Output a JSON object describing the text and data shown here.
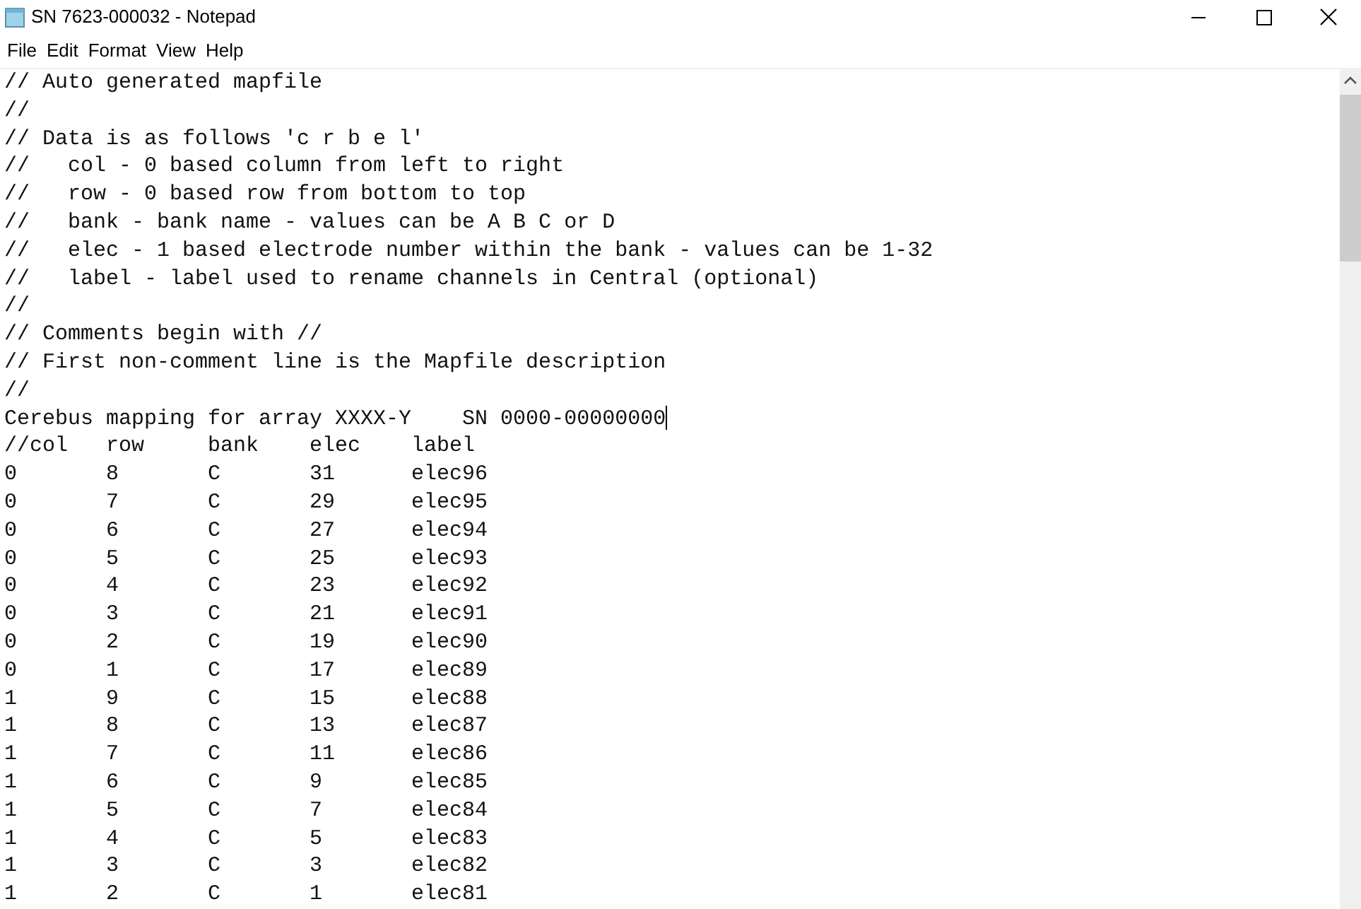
{
  "window": {
    "title": "SN 7623-000032 - Notepad"
  },
  "menu": [
    "File",
    "Edit",
    "Format",
    "View",
    "Help"
  ],
  "lines": [
    {
      "text": "// Auto generated mapfile",
      "caret": false
    },
    {
      "text": "//",
      "caret": false
    },
    {
      "text": "// Data is as follows 'c r b e l'",
      "caret": false
    },
    {
      "text": "//   col - 0 based column from left to right",
      "caret": false
    },
    {
      "text": "//   row - 0 based row from bottom to top",
      "caret": false
    },
    {
      "text": "//   bank - bank name - values can be A B C or D",
      "caret": false
    },
    {
      "text": "//   elec - 1 based electrode number within the bank - values can be 1-32",
      "caret": false
    },
    {
      "text": "//   label - label used to rename channels in Central (optional)",
      "caret": false
    },
    {
      "text": "//",
      "caret": false
    },
    {
      "text": "// Comments begin with //",
      "caret": false
    },
    {
      "text": "// First non-comment line is the Mapfile description",
      "caret": false
    },
    {
      "text": "//",
      "caret": false
    },
    {
      "text": "Cerebus mapping for array XXXX-Y    SN 0000-00000000",
      "caret": true
    },
    {
      "text": "//col\trow\tbank\telec\tlabel",
      "caret": false
    },
    {
      "text": "0\t8\tC\t31\telec96",
      "caret": false
    },
    {
      "text": "0\t7\tC\t29\telec95",
      "caret": false
    },
    {
      "text": "0\t6\tC\t27\telec94",
      "caret": false
    },
    {
      "text": "0\t5\tC\t25\telec93",
      "caret": false
    },
    {
      "text": "0\t4\tC\t23\telec92",
      "caret": false
    },
    {
      "text": "0\t3\tC\t21\telec91",
      "caret": false
    },
    {
      "text": "0\t2\tC\t19\telec90",
      "caret": false
    },
    {
      "text": "0\t1\tC\t17\telec89",
      "caret": false
    },
    {
      "text": "1\t9\tC\t15\telec88",
      "caret": false
    },
    {
      "text": "1\t8\tC\t13\telec87",
      "caret": false
    },
    {
      "text": "1\t7\tC\t11\telec86",
      "caret": false
    },
    {
      "text": "1\t6\tC\t9\telec85",
      "caret": false
    },
    {
      "text": "1\t5\tC\t7\telec84",
      "caret": false
    },
    {
      "text": "1\t4\tC\t5\telec83",
      "caret": false
    },
    {
      "text": "1\t3\tC\t3\telec82",
      "caret": false
    },
    {
      "text": "1\t2\tC\t1\telec81",
      "caret": false
    }
  ]
}
